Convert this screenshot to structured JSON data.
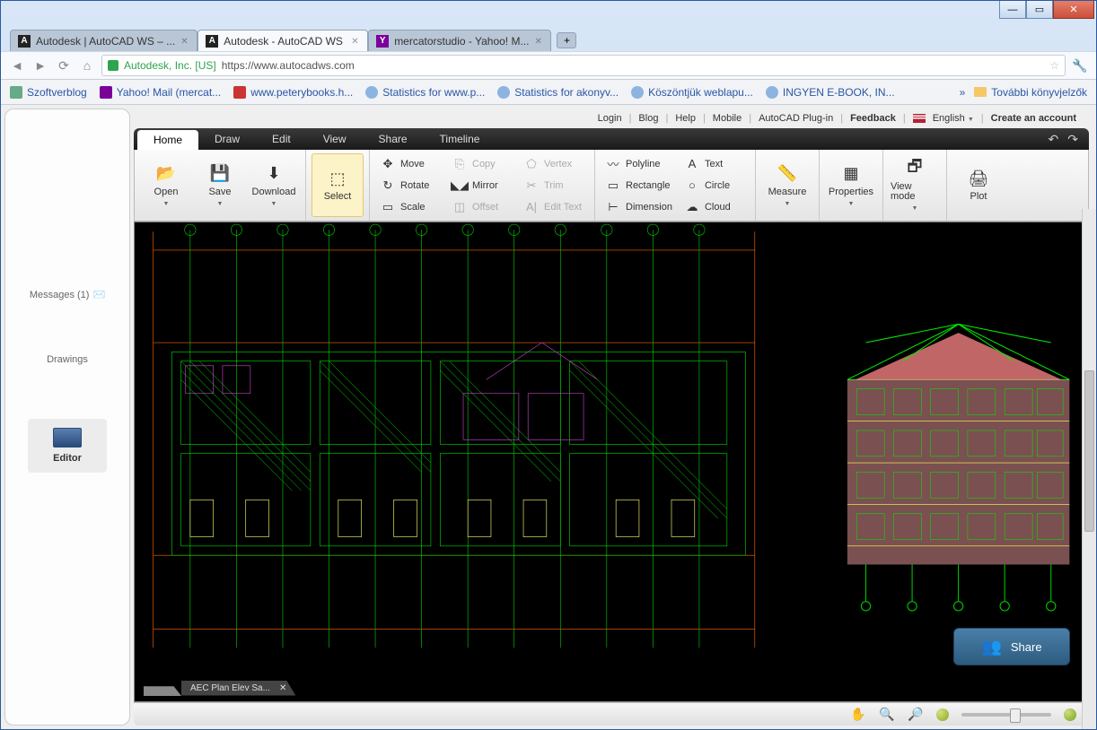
{
  "window": {
    "tabs": [
      {
        "label": "Autodesk | AutoCAD WS – ...",
        "favicon": "A"
      },
      {
        "label": "Autodesk - AutoCAD WS",
        "favicon": "A"
      },
      {
        "label": "mercatorstudio - Yahoo! M...",
        "favicon": "Y"
      }
    ],
    "url_owner": "Autodesk, Inc. [US]",
    "url": "https://www.autocadws.com"
  },
  "bookmarks": {
    "items": [
      "Szoftverblog",
      "Yahoo! Mail (mercat...",
      "www.peterybooks.h...",
      "Statistics for www.p...",
      "Statistics for akonyv...",
      "Köszöntjük weblapu...",
      "INGYEN E-BOOK, IN..."
    ],
    "more": "»",
    "right": "További könyvjelzők"
  },
  "toplinks": {
    "login": "Login",
    "blog": "Blog",
    "help": "Help",
    "mobile": "Mobile",
    "plugin": "AutoCAD Plug-in",
    "feedback": "Feedback",
    "language": "English",
    "create": "Create an account"
  },
  "sidebar": {
    "messages_label": "Messages (1)",
    "drawings_label": "Drawings",
    "editor_label": "Editor"
  },
  "ribbon_tabs": [
    "Home",
    "Draw",
    "Edit",
    "View",
    "Share",
    "Timeline"
  ],
  "ribbon": {
    "file": {
      "open": "Open",
      "save": "Save",
      "download": "Download"
    },
    "select": "Select",
    "edit1": {
      "move": "Move",
      "rotate": "Rotate",
      "scale": "Scale"
    },
    "edit2": {
      "copy": "Copy",
      "mirror": "Mirror",
      "offset": "Offset"
    },
    "edit3": {
      "vertex": "Vertex",
      "trim": "Trim",
      "edittext": "Edit Text"
    },
    "draw1": {
      "polyline": "Polyline",
      "rectangle": "Rectangle",
      "dimension": "Dimension"
    },
    "draw2": {
      "text": "Text",
      "circle": "Circle",
      "cloud": "Cloud"
    },
    "measure": "Measure",
    "properties": "Properties",
    "viewmode": "View mode",
    "plot": "Plot"
  },
  "doc_tab": "AEC Plan Elev Sa...",
  "share_button": "Share"
}
